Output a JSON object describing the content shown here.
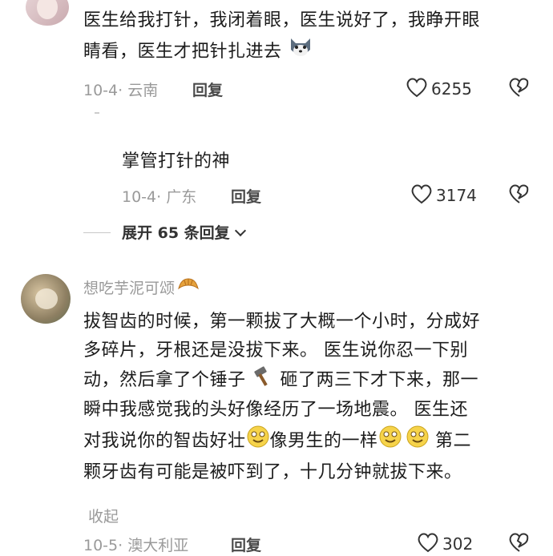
{
  "comments": [
    {
      "text_line1": "医生给我打针，我闭着眼，医生说好了，我睁开眼",
      "text_line2": "睛看，医生才把针扎进去",
      "date_loc": "10-4· 云南",
      "reply_label": "回复",
      "likes": "6255"
    },
    {
      "text": "掌管打针的神",
      "date_loc": "10-4· 广东",
      "reply_label": "回复",
      "likes": "3174"
    },
    {
      "expand_label": "展开 65 条回复"
    },
    {
      "username": "想吃芋泥可颂",
      "line1": "拔智齿的时候，第一颗拔了大概一个小时，分成好",
      "line2": "多碎片，牙根还是没拔下来。 医生说你忍一下别",
      "line3a": "动，然后拿了个锤子",
      "line3b": "砸了两三下才下来，那一",
      "line4": "瞬中我感觉我的头好像经历了一场地震。 医生还",
      "line5a": "对我说你的智齿好壮",
      "line5b": "像男生的一样",
      "line5c": " 第二",
      "line6": "颗牙齿有可能是被吓到了，十几分钟就拔下来。",
      "collapse_label": "收起",
      "date_loc": "10-5· 澳大利亚",
      "reply_label": "回复",
      "likes": "302"
    }
  ],
  "icons": [
    "avatar-top",
    "husky-emoji-icon",
    "heart-icon",
    "broken-heart-icon",
    "croissant-icon",
    "hammer-icon",
    "smile-emoji-icon"
  ]
}
